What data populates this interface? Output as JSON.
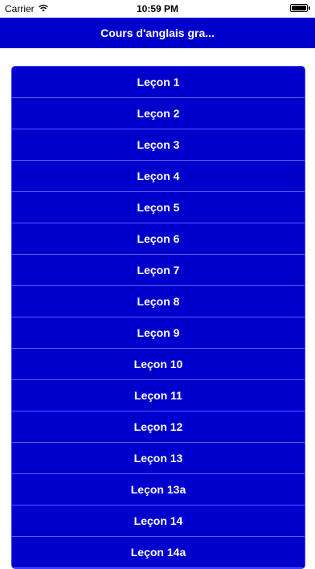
{
  "status_bar": {
    "carrier": "Carrier",
    "time": "10:59 PM",
    "icons": [
      "wifi-icon",
      "battery-icon"
    ]
  },
  "nav": {
    "title": "Cours d'anglais gra..."
  },
  "lessons": [
    "Leçon 1",
    "Leçon 2",
    "Leçon 3",
    "Leçon 4",
    "Leçon 5",
    "Leçon 6",
    "Leçon 7",
    "Leçon 8",
    "Leçon 9",
    "Leçon 10",
    "Leçon 11",
    "Leçon 12",
    "Leçon 13",
    "Leçon 13a",
    "Leçon 14",
    "Leçon 14a"
  ],
  "colors": {
    "primary": "#0000cc",
    "separator": "#5a5aff",
    "text": "#ffffff"
  }
}
